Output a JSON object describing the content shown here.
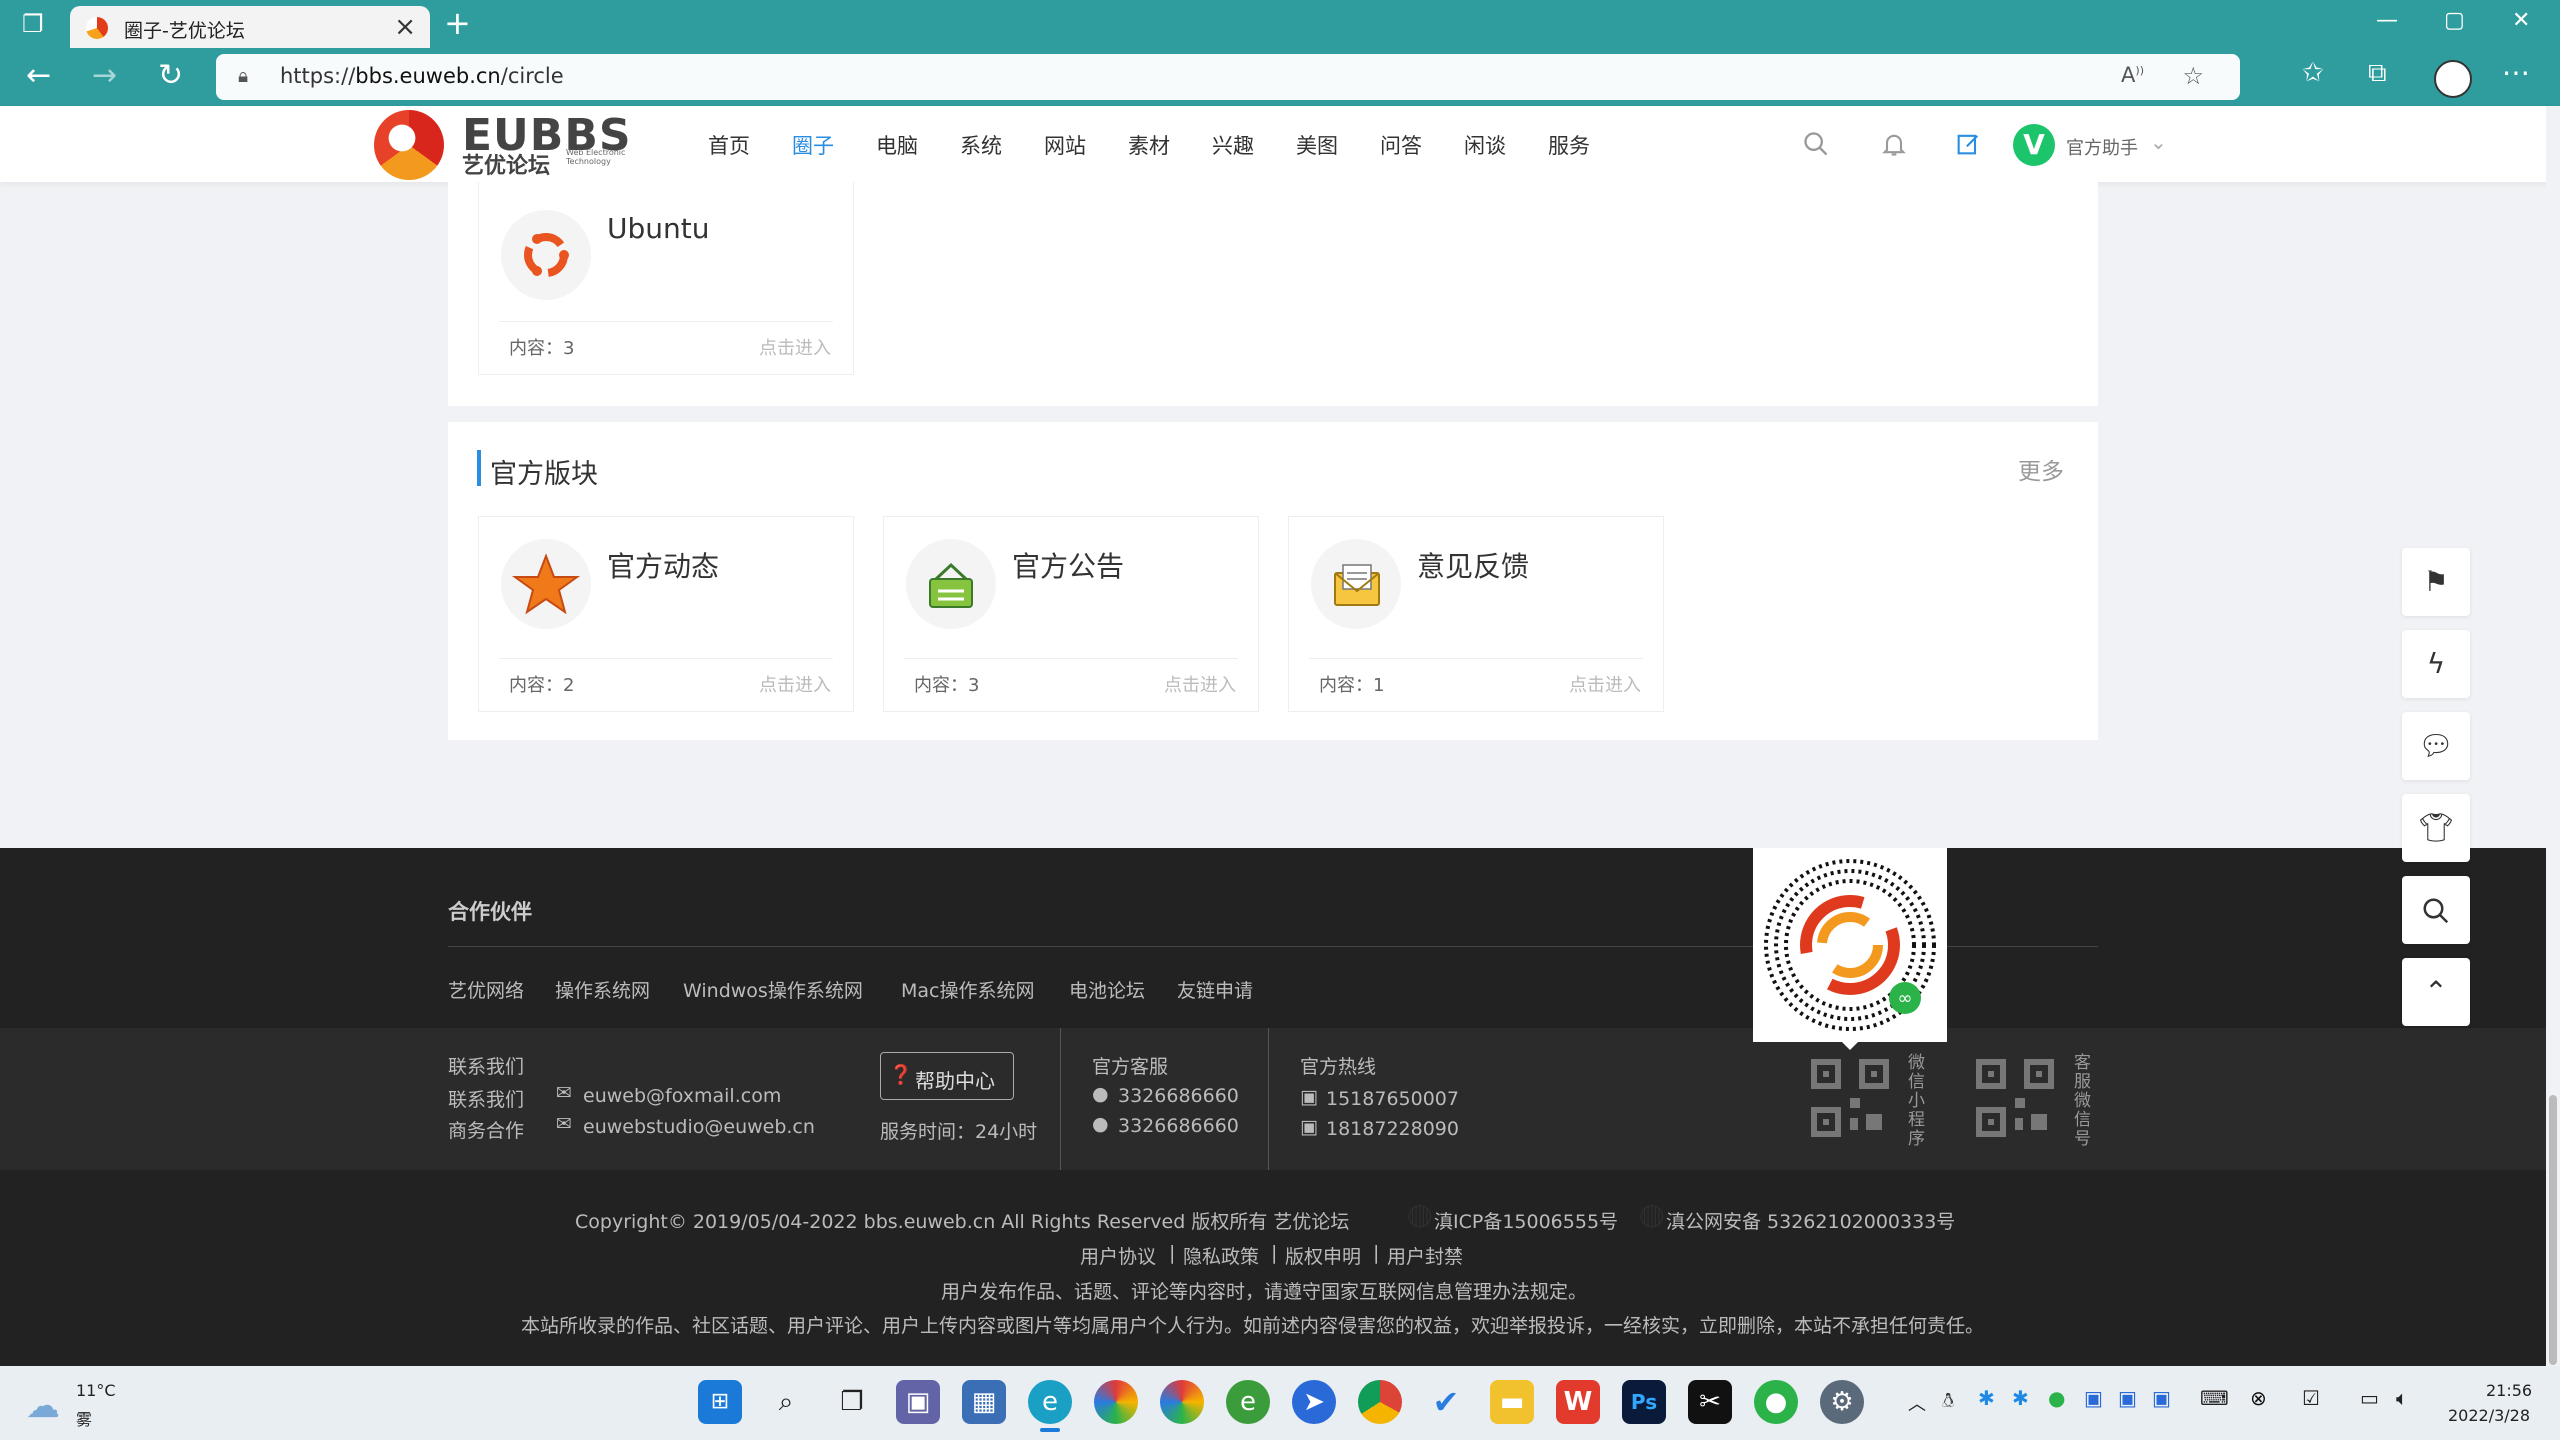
{
  "browser": {
    "tab_title": "圈子-艺优论坛",
    "tab_close": "×",
    "new_tab": "+",
    "url_scheme": "https://",
    "url_host": "bbs.euweb.cn",
    "url_path": "/circle",
    "window_min": "—",
    "window_max": "▢",
    "window_close": "✕"
  },
  "site": {
    "logo_text": "EUBBS",
    "logo_sub": "艺优论坛",
    "logo_en": "Web Electronic Technology",
    "nav": [
      "首页",
      "圈子",
      "电脑",
      "系统",
      "网站",
      "素材",
      "兴趣",
      "美图",
      "问答",
      "闲谈",
      "服务"
    ],
    "nav_active_index": 1,
    "user_initial": "V",
    "username": "官方助手"
  },
  "top_card": {
    "name": "Ubuntu",
    "meta": "内容：3",
    "enter": "点击进入"
  },
  "official": {
    "title": "官方版块",
    "more": "更多",
    "cards": [
      {
        "name": "官方动态",
        "meta": "内容：2",
        "enter": "点击进入"
      },
      {
        "name": "官方公告",
        "meta": "内容：3",
        "enter": "点击进入"
      },
      {
        "name": "意见反馈",
        "meta": "内容：1",
        "enter": "点击进入"
      }
    ]
  },
  "footer": {
    "partners_title": "合作伙伴",
    "partners": [
      "艺优网络",
      "操作系统网",
      "Windwos操作系统网",
      "Mac操作系统网",
      "电池论坛",
      "友链申请"
    ],
    "contact_title": "联系我们",
    "contact_label": "联系我们",
    "contact_email": "euweb@foxmail.com",
    "biz_label": "商务合作",
    "biz_email": "euwebstudio@euweb.cn",
    "help_button": "帮助中心",
    "service_time": "服务时间：24小时",
    "kefu_title": "官方客服",
    "kefu_qq1": "3326686660",
    "kefu_qq2": "3326686660",
    "hotline_title": "官方热线",
    "hotline1": "15187650007",
    "hotline2": "18187228090",
    "qr1_label": "微信小程序",
    "qr2_label": "客服微信号",
    "copyright": "Copyright© 2019/05/04-2022 bbs.euweb.cn All Rights Reserved 版权所有 艺优论坛",
    "icp": "滇ICP备15006555号",
    "police": "滇公网安备 53262102000333号",
    "links": [
      "用户协议",
      "隐私政策",
      "版权申明",
      "用户封禁"
    ],
    "notice1": "用户发布作品、话题、评论等内容时，请遵守国家互联网信息管理办法规定。",
    "notice2": "本站所收录的作品、社区话题、用户评论、用户上传内容或图片等均属用户个人行为。如前述内容侵害您的权益，欢迎举报投诉，一经核实，立即删除，本站不承担任何责任。"
  },
  "taskbar": {
    "weather_temp": "11°C",
    "weather_desc": "雾",
    "time": "21:56",
    "date": "2022/3/28"
  }
}
